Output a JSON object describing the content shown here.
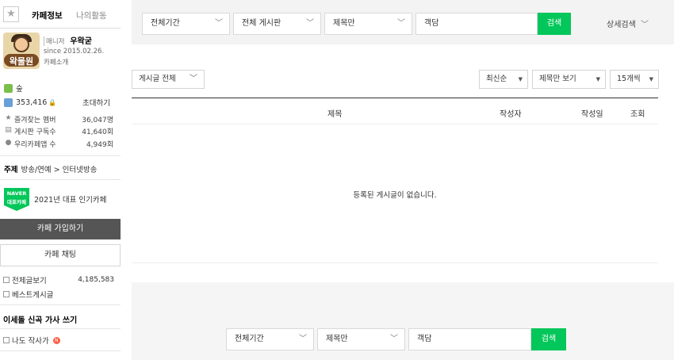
{
  "sidebar": {
    "tabs": {
      "info": "카페정보",
      "activity": "나의활동"
    },
    "profile": {
      "logo_text": "왁물원",
      "manager_tag": "매니저",
      "manager_name": "우왁굳",
      "since": "since 2015.02.26.",
      "cafe_intro": "카페소개"
    },
    "grade": "숲",
    "member_count": "353,416",
    "invite": "초대하기",
    "stats": [
      {
        "label": "즐겨찾는 멤버",
        "value": "36,047명",
        "icon": "star-icon"
      },
      {
        "label": "게시판 구독수",
        "value": "41,640회",
        "icon": "board-icon"
      },
      {
        "label": "우리카페앱 수",
        "value": "4,949회",
        "icon": "app-icon"
      }
    ],
    "topic_label": "주제",
    "topic_value": "방송/연예 > 인터넷방송",
    "badge": {
      "line1": "NAVER",
      "line2": "대표카페"
    },
    "popular": "2021년 대표 인기카페",
    "join_button": "카페 가입하기",
    "chat_button": "카페 채팅",
    "boards": [
      {
        "label": "전체글보기",
        "value": "4,185,583"
      },
      {
        "label": "베스트게시글",
        "value": ""
      }
    ],
    "section_title": "이세돌 신곡 가사 쓰기",
    "me_writer": "나도 작사가",
    "new_badge": "N",
    "accent_color": "#03c75a"
  },
  "search_top": {
    "period": "전체기간",
    "board": "전체 게시판",
    "scope": "제목만",
    "query": "객담",
    "button": "검색",
    "advanced": "상세검색"
  },
  "list_controls": {
    "filter": "게시글 전체",
    "sort": "최신순",
    "view": "제목만 보기",
    "per_page": "15개씩"
  },
  "table": {
    "headers": [
      "제목",
      "작성자",
      "작성일",
      "조회"
    ],
    "empty_message": "등록된 게시글이 없습니다."
  },
  "search_bottom": {
    "period": "전체기간",
    "scope": "제목만",
    "query": "객담",
    "button": "검색"
  }
}
